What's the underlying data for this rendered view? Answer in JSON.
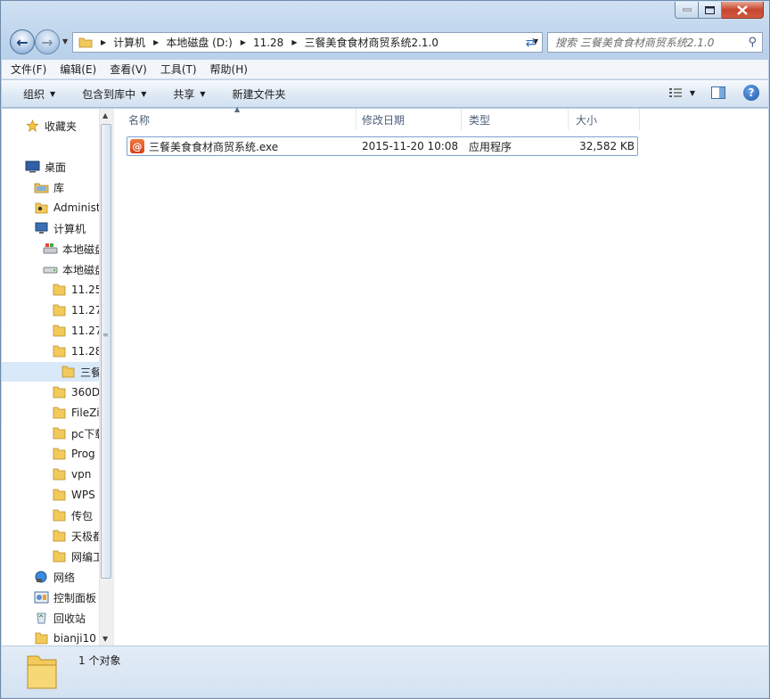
{
  "window": {
    "minimize_icon": "minimize-icon",
    "maximize_icon": "maximize-icon",
    "close_icon": "close-icon"
  },
  "nav": {
    "back_icon": "back-arrow-icon",
    "forward_icon": "forward-arrow-icon",
    "breadcrumbs": [
      "计算机",
      "本地磁盘 (D:)",
      "11.28",
      "三餐美食食材商贸系统2.1.0"
    ],
    "search_placeholder": "搜索 三餐美食食材商贸系统2.1.0"
  },
  "menu": {
    "items": [
      "文件(F)",
      "编辑(E)",
      "查看(V)",
      "工具(T)",
      "帮助(H)"
    ]
  },
  "toolbar": {
    "organize": "组织",
    "include_library": "包含到库中",
    "share": "共享",
    "new_folder": "新建文件夹"
  },
  "sidebar": {
    "items": [
      {
        "label": "收藏夹",
        "icon": "favorites-star-icon"
      },
      {
        "label": "桌面",
        "icon": "desktop-icon"
      },
      {
        "label": "库",
        "icon": "library-icon"
      },
      {
        "label": "Administ",
        "icon": "user-folder-icon"
      },
      {
        "label": "计算机",
        "icon": "computer-icon"
      },
      {
        "label": "本地磁盘",
        "icon": "system-drive-icon"
      },
      {
        "label": "本地磁盘",
        "icon": "drive-icon"
      },
      {
        "label": "11.25",
        "icon": "folder-icon"
      },
      {
        "label": "11.27",
        "icon": "folder-icon"
      },
      {
        "label": "11.27",
        "icon": "folder-icon"
      },
      {
        "label": "11.28",
        "icon": "folder-icon"
      },
      {
        "label": "三餐",
        "icon": "folder-icon"
      },
      {
        "label": "360D",
        "icon": "folder-icon"
      },
      {
        "label": "FileZi",
        "icon": "folder-icon"
      },
      {
        "label": "pc下载",
        "icon": "folder-icon"
      },
      {
        "label": "Prog",
        "icon": "folder-icon"
      },
      {
        "label": "vpn",
        "icon": "folder-icon"
      },
      {
        "label": "WPS",
        "icon": "folder-icon"
      },
      {
        "label": "传包",
        "icon": "folder-icon"
      },
      {
        "label": "天极都",
        "icon": "folder-icon"
      },
      {
        "label": "网编工",
        "icon": "folder-icon"
      },
      {
        "label": "网络",
        "icon": "network-icon"
      },
      {
        "label": "控制面板",
        "icon": "control-panel-icon"
      },
      {
        "label": "回收站",
        "icon": "recycle-bin-icon"
      },
      {
        "label": "bianji10",
        "icon": "folder-icon"
      }
    ]
  },
  "columns": {
    "name": "名称",
    "modified": "修改日期",
    "type": "类型",
    "size": "大小"
  },
  "files": [
    {
      "name": "三餐美食食材商贸系统.exe",
      "modified": "2015-11-20 10:08",
      "type": "应用程序",
      "size": "32,582 KB",
      "icon": "exe-app-icon"
    }
  ],
  "status": {
    "text": "1 个对象"
  }
}
